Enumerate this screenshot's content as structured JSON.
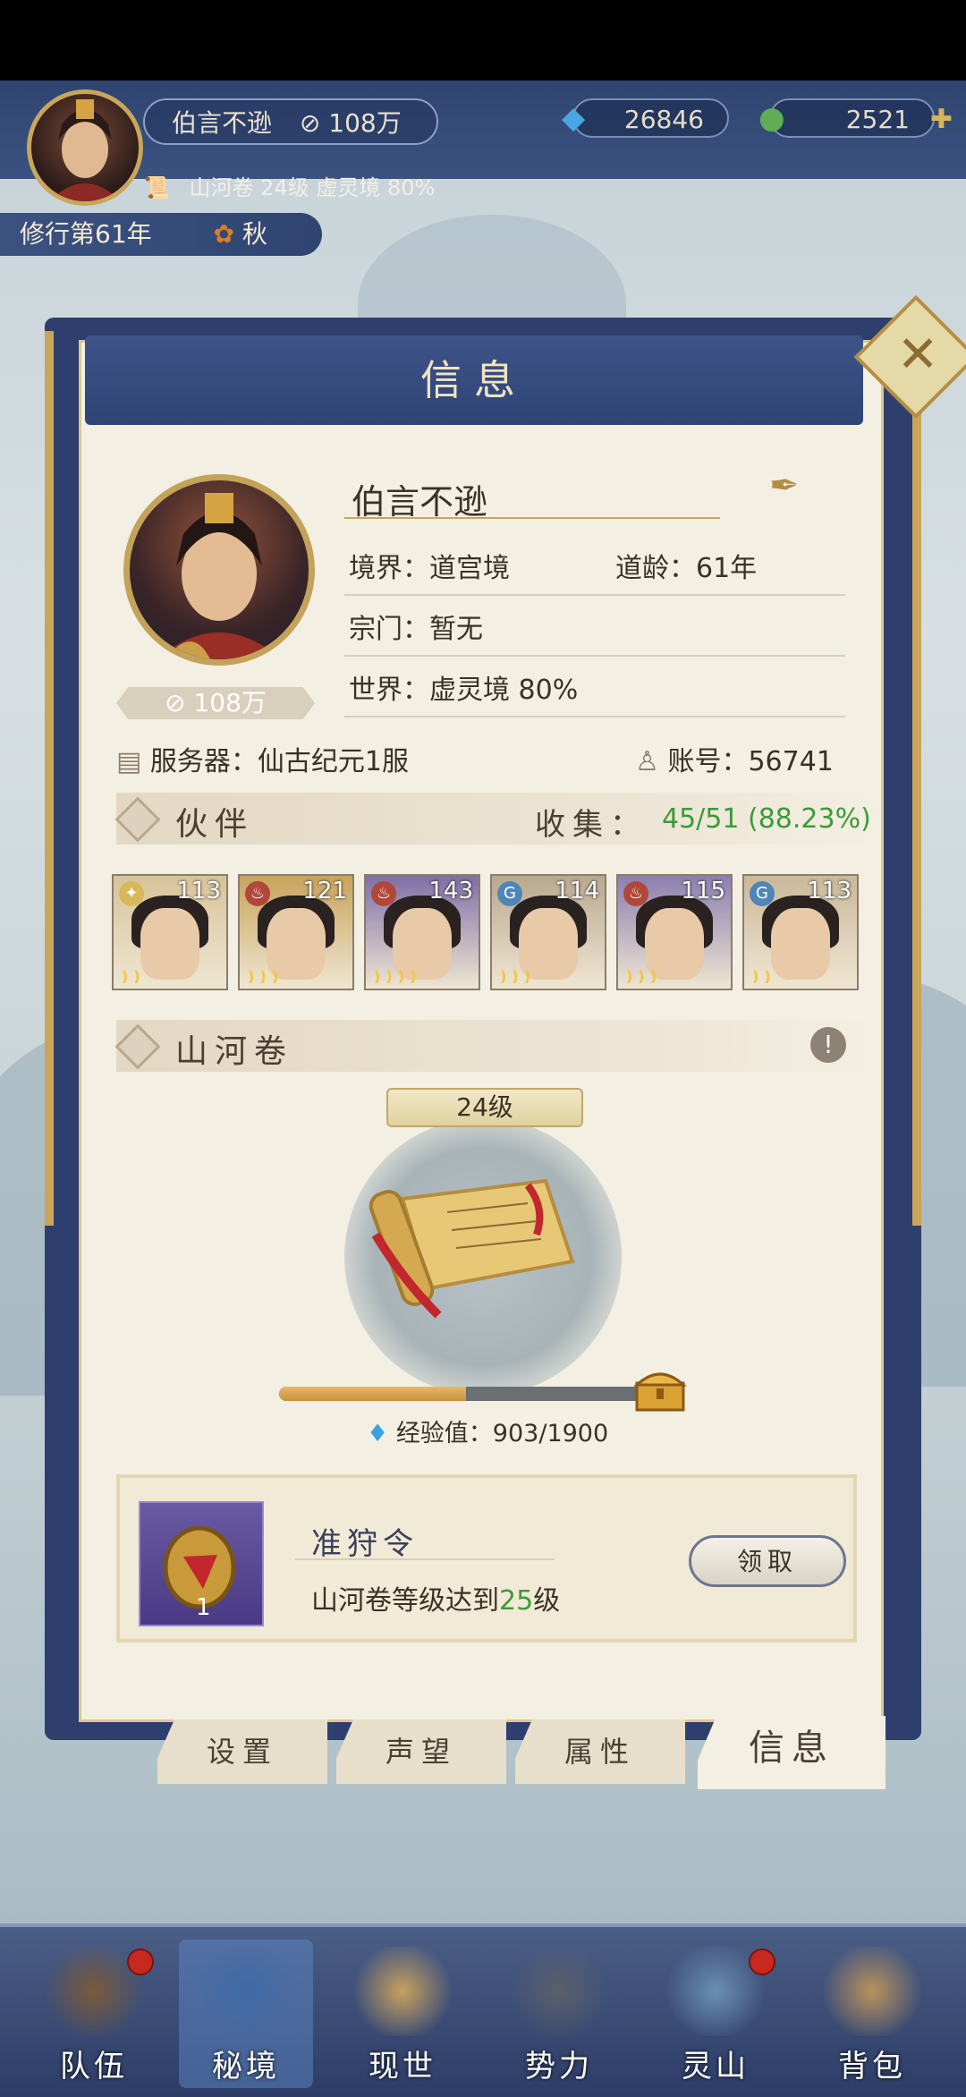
{
  "player": {
    "name": "伯言不逊",
    "power": "108万",
    "scroll_summary": "山河卷 24级 虚灵境 80%",
    "cultivation_year": "修行第61年",
    "season": "秋"
  },
  "resources": {
    "crystal": "26846",
    "jade": "2521"
  },
  "panel": {
    "title": "信息",
    "close": "✕"
  },
  "profile": {
    "name": "伯言不逊",
    "realm": "境界：道宫境",
    "dao_age": "道龄：61年",
    "sect": "宗门：暂无",
    "world": "世界：虚灵境  80%",
    "power": "108万",
    "server": "服务器：仙古纪元1服",
    "account": "账号：56741"
  },
  "partners": {
    "title": "伙伴",
    "collect_label": "收集：",
    "collect_value": "45/51 (88.23%)",
    "cards": [
      {
        "level": "113",
        "element": "✦",
        "element_color": "#d9b85a",
        "bg": "#d8c49a",
        "stars": "❫❫"
      },
      {
        "level": "121",
        "element": "♨",
        "element_color": "#b0483a",
        "bg": "#c8a35c",
        "stars": "❫❫❫"
      },
      {
        "level": "143",
        "element": "♨",
        "element_color": "#b0483a",
        "bg": "#7f6fa7",
        "stars": "❫❫❫❫"
      },
      {
        "level": "114",
        "element": "G",
        "element_color": "#4f86b8",
        "bg": "#b9a890",
        "stars": "❫❫❫"
      },
      {
        "level": "115",
        "element": "♨",
        "element_color": "#b0483a",
        "bg": "#8c7fb0",
        "stars": "❫❫❫"
      },
      {
        "level": "113",
        "element": "G",
        "element_color": "#4f86b8",
        "bg": "#cbb89a",
        "stars": "❫❫"
      }
    ]
  },
  "scroll": {
    "title": "山河卷",
    "level": "24级",
    "exp_label": "经验值：903/1900",
    "progress": 0.475
  },
  "reward": {
    "name": "准狩令",
    "count": "1",
    "desc_prefix": "山河卷等级达到",
    "desc_level": "25",
    "desc_suffix": "级",
    "button": "领取"
  },
  "tabs": [
    "设置",
    "声望",
    "属性",
    "信息"
  ],
  "nav": [
    {
      "label": "队伍",
      "dot": true,
      "color": "#7a5a3a"
    },
    {
      "label": "秘境",
      "dot": false,
      "color": "#3f6aa6"
    },
    {
      "label": "现世",
      "dot": false,
      "color": "#c7a15e"
    },
    {
      "label": "势力",
      "dot": false,
      "color": "#5b5f6b"
    },
    {
      "label": "灵山",
      "dot": true,
      "color": "#6a8fb5"
    },
    {
      "label": "背包",
      "dot": false,
      "color": "#b9935a"
    }
  ],
  "colors": {
    "accent_green": "#3b9b3a",
    "panel_blue": "#2f4375"
  }
}
